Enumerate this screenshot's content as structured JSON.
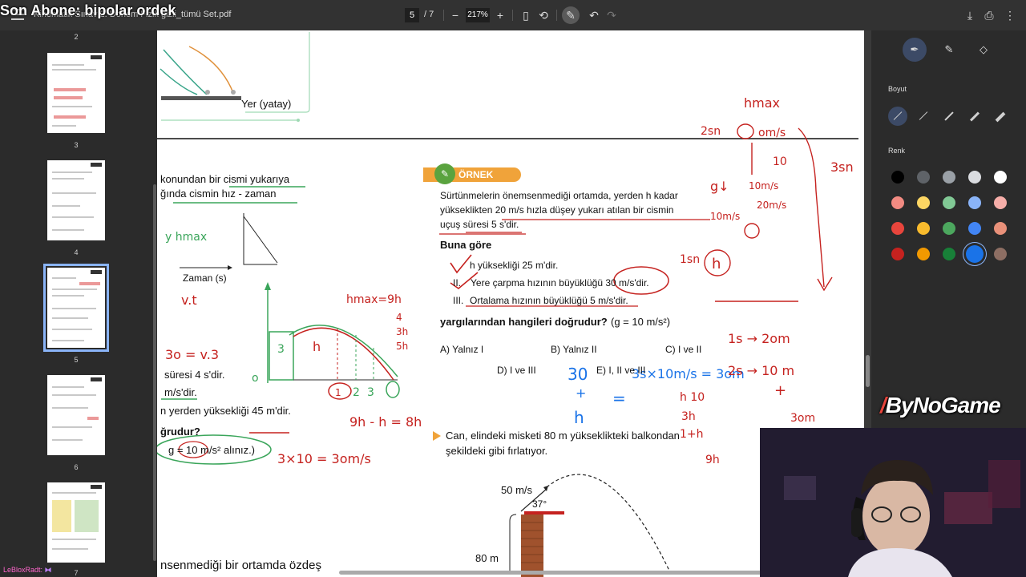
{
  "overlay": {
    "title": "Son Abone: bipolar ordek"
  },
  "toolbar": {
    "filename": "Kinematik Sınav 2. Dönem Fizik gizli_tümü Set.pdf",
    "current_page": "5",
    "total_pages": "/ 7",
    "zoom": "217%"
  },
  "sidebar": {
    "page_numbers": [
      "2",
      "3",
      "4",
      "5",
      "6",
      "7"
    ],
    "selected_page": "5",
    "username": "LeBloxRadt"
  },
  "document": {
    "left_column": {
      "line1": "konundan bir cismi yukarıya",
      "line2": "ğında cismin hız - zaman",
      "axis_label": "Zaman (s)",
      "ground_label": "Yer (yatay)",
      "stmt_time": "süresi 4 s'dir.",
      "stmt_speed": "m/s'dir.",
      "stmt_height": "n yerden yüksekliği 45 m'dir.",
      "question_stub": "ğrudur?",
      "g_note": "g = 10 m/s² alınız.)",
      "bottom_line": "nsenmediği bir ortamda özdeş"
    },
    "example": {
      "badge": "ÖRNEK",
      "p1": "Sürtünmelerin önemsenmediği ortamda, yerden h kadar",
      "p2": "yükseklikten 20 m/s hızla düşey yukarı atılan bir cismin",
      "p3": "uçuş süresi 5 s'dir.",
      "buna_gore": "Buna göre",
      "s1": "h yüksekliği 25 m'dir.",
      "s2_num": "II.",
      "s2": "Yere çarpma hızının büyüklüğü 30 m/s'dir.",
      "s3_num": "III.",
      "s3": "Ortalama hızının büyüklüğü 5 m/s'dir.",
      "question": "yargılarından hangileri doğrudur?",
      "g_value": "(g = 10 m/s²)",
      "options": [
        "A) Yalnız I",
        "B) Yalnız II",
        "C) I ve II",
        "D) I ve III",
        "E) I, II ve III"
      ]
    },
    "problem2": {
      "line1": "Can, elindeki misketi 80 m yükseklikteki balkondan",
      "line2": "şekildeki gibi fırlatıyor.",
      "velocity": "50 m/s",
      "angle": "37°",
      "height": "80 m"
    }
  },
  "right_panel": {
    "size_label": "Boyut",
    "color_label": "Renk",
    "colors": [
      "#000000",
      "#5f6368",
      "#9aa0a6",
      "#dadce0",
      "#ffffff",
      "#f28b82",
      "#fdd663",
      "#81c995",
      "#8ab4f8",
      "#f6aea9",
      "#e8453c",
      "#f9bb2d",
      "#4ca75e",
      "#4285f4",
      "#e9917a",
      "#c5221f",
      "#f29900",
      "#188038",
      "#1a73e8",
      "#8d6e63"
    ],
    "selected_color_index": 18
  },
  "watermark": "ByNoGame"
}
